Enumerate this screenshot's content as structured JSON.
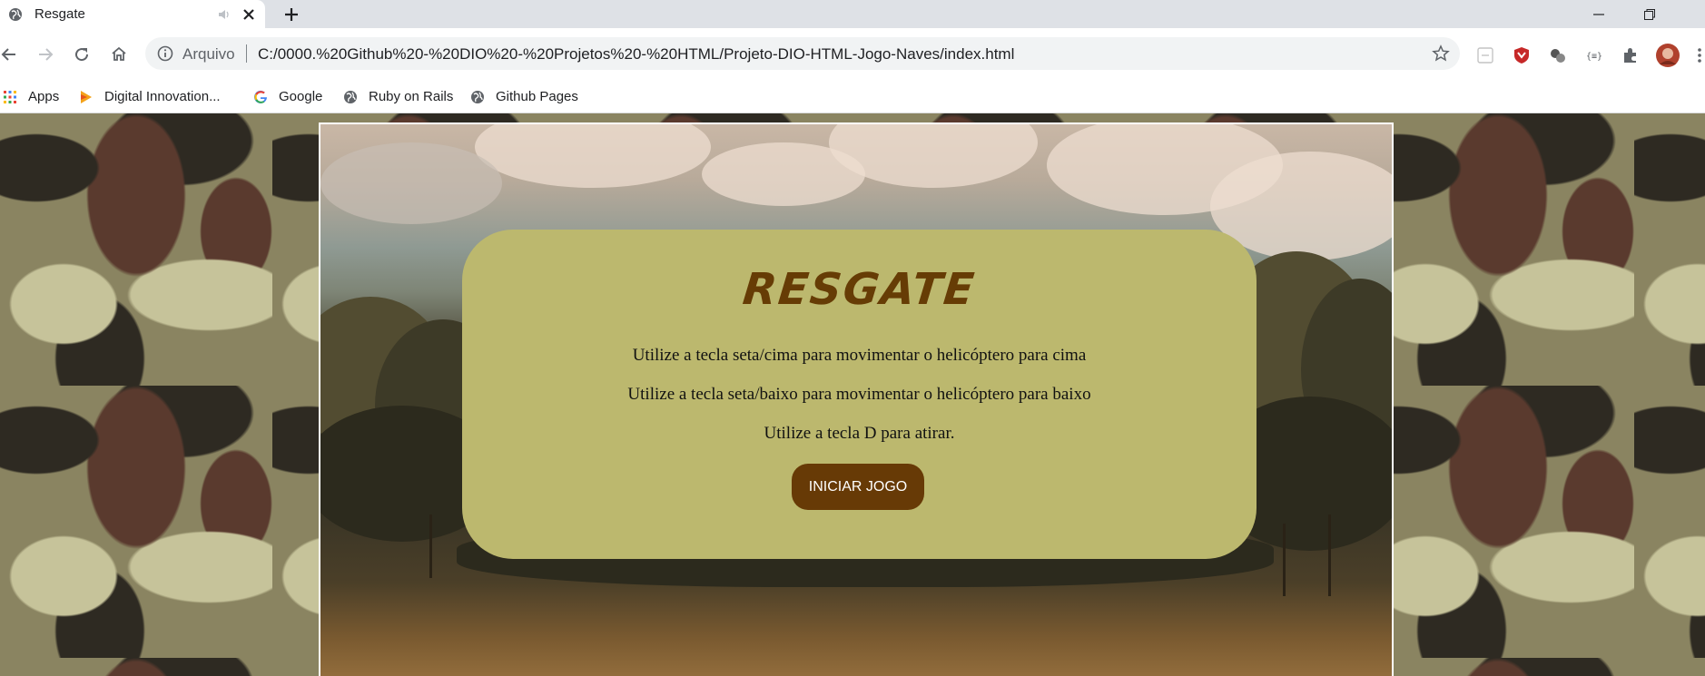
{
  "browser": {
    "tab": {
      "title": "Resgate"
    },
    "address": {
      "scheme_label": "Arquivo",
      "url": "C:/0000.%20Github%20-%20DIO%20-%20Projetos%20-%20HTML/Projeto-DIO-HTML-Jogo-Naves/index.html"
    },
    "bookmarks": [
      {
        "label": "Apps",
        "icon": "apps-grid-icon"
      },
      {
        "label": "Digital Innovation...",
        "icon": "dio-icon"
      },
      {
        "label": "Google",
        "icon": "google-icon"
      },
      {
        "label": "Ruby on Rails",
        "icon": "globe-icon"
      },
      {
        "label": "Github Pages",
        "icon": "globe-icon"
      }
    ]
  },
  "game": {
    "title": "RESGATE",
    "instructions": [
      "Utilize a tecla seta/cima para movimentar o helicóptero para cima",
      "Utilize a tecla seta/baixo para movimentar o helicóptero para baixo",
      "Utilize a tecla D para atirar."
    ],
    "start_button": "INICIAR JOGO"
  },
  "colors": {
    "panel": "#bcb86e",
    "title": "#663c05",
    "button": "#673a06"
  }
}
